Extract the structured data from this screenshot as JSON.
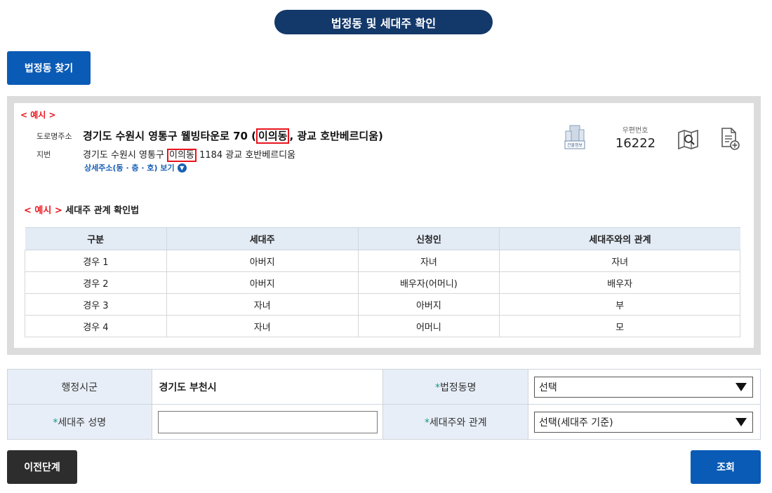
{
  "title": "법정동 및 세대주 확인",
  "find_button": "법정동 찾기",
  "example": {
    "label": "< 예시 >",
    "road_tag": "도로명주소",
    "road_pre": "경기도 수원시 영통구 웰빙타운로 70 (",
    "road_hl": "이의동",
    "road_post": ", 광교 호반베르디움)",
    "jibun_tag": "지번",
    "jibun_pre": "경기도 수원시 영통구 ",
    "jibun_hl": "이의동",
    "jibun_post": " 1184 광교 호반베르디움",
    "detail_link": "상세주소(동 · 층 · 호) 보기",
    "postal_label": "우편번호",
    "postal_code": "16222",
    "building_icon_text": "건물정보"
  },
  "relation": {
    "label_red": "< 예시 >",
    "label": " 세대주 관계 확인법",
    "headers": [
      "구분",
      "세대주",
      "신청인",
      "세대주와의 관계"
    ],
    "rows": [
      [
        "경우 1",
        "아버지",
        "자녀",
        "자녀"
      ],
      [
        "경우 2",
        "아버지",
        "배우자(어머니)",
        "배우자"
      ],
      [
        "경우 3",
        "자녀",
        "아버지",
        "부"
      ],
      [
        "경우 4",
        "자녀",
        "어머니",
        "모"
      ]
    ]
  },
  "form": {
    "district_label": "행정시군",
    "district_value": "경기도 부천시",
    "required_mark": "*",
    "dong_label": "법정동명",
    "dong_selected": "선택",
    "name_label": "세대주 성명",
    "name_value": "",
    "rel_label": "세대주와 관계",
    "rel_selected": "선택(세대주 기준)"
  },
  "buttons": {
    "prev": "이전단계",
    "query": "조회"
  },
  "colors": {
    "navy": "#13386a",
    "blue": "#0a5bb5",
    "red": "#e8141e",
    "dark": "#2d2d2d",
    "teal": "#0f9a8a"
  }
}
